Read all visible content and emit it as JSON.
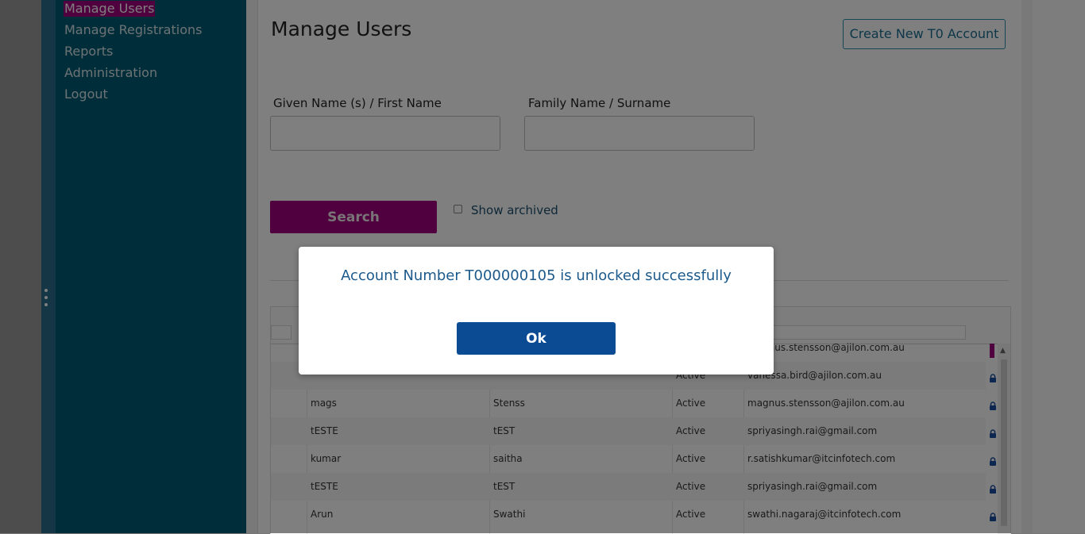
{
  "sidebar": {
    "items": [
      {
        "label": "Manage Users",
        "active": true
      },
      {
        "label": "Manage Registrations"
      },
      {
        "label": "Reports"
      },
      {
        "label": "Administration"
      },
      {
        "label": "Logout"
      }
    ]
  },
  "main": {
    "title": "Manage Users",
    "create_button": "Create New T0 Account",
    "search": {
      "given_name_label": "Given Name (s) / First Name",
      "given_name_value": "",
      "family_name_label": "Family Name / Surname",
      "family_name_value": "",
      "search_button": "Search",
      "show_archived_label": "Show archived",
      "show_archived_checked": false
    }
  },
  "grid": {
    "rows": [
      {
        "first": "",
        "last": "",
        "status": "",
        "email": "magnus.stensson@ajilon.com.au"
      },
      {
        "first": "",
        "last": "",
        "status": "Active",
        "email": "vanessa.bird@ajilon.com.au"
      },
      {
        "first": "mags",
        "last": "Stenss",
        "status": "Active",
        "email": "magnus.stensson@ajilon.com.au"
      },
      {
        "first": "tESTE",
        "last": "tEST",
        "status": "Active",
        "email": "spriyasingh.rai@gmail.com"
      },
      {
        "first": "kumar",
        "last": "saitha",
        "status": "Active",
        "email": "r.satishkumar@itcinfotech.com"
      },
      {
        "first": "tESTE",
        "last": "tEST",
        "status": "Active",
        "email": "spriyasingh.rai@gmail.com"
      },
      {
        "first": "Arun",
        "last": "Swathi",
        "status": "Active",
        "email": "swathi.nagaraj@itcinfotech.com"
      }
    ]
  },
  "modal": {
    "message": "Account Number T000000105 is unlocked successfully",
    "ok_label": "Ok"
  },
  "colors": {
    "sidebar": "#005b74",
    "accent_magenta": "#a0007c",
    "ok_button": "#0b4b94",
    "message_text": "#1c5a8c"
  },
  "icons": [
    "lock-icon",
    "scroll-up-icon",
    "sidebar-handle-icon"
  ]
}
